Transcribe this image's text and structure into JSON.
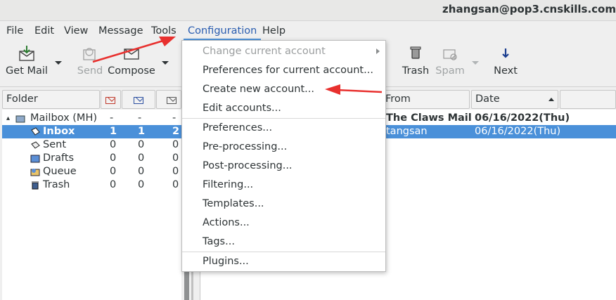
{
  "window": {
    "title": "zhangsan@pop3.cnskills.com"
  },
  "menubar": {
    "items": [
      "File",
      "Edit",
      "View",
      "Message",
      "Tools",
      "Configuration",
      "Help"
    ],
    "active": "Configuration"
  },
  "toolbar": {
    "get_mail": "Get Mail",
    "send": "Send",
    "compose": "Compose",
    "trash": "Trash",
    "spam": "Spam",
    "next": "Next"
  },
  "folder_header": {
    "folder": "Folder"
  },
  "folders": [
    {
      "name": "Mailbox (MH)",
      "c1": "-",
      "c2": "-",
      "c3": "-",
      "icon": "mailbox-icon",
      "selected": false,
      "expander": "▴"
    },
    {
      "name": "Inbox",
      "c1": "1",
      "c2": "1",
      "c3": "2",
      "icon": "inbox-icon",
      "selected": true
    },
    {
      "name": "Sent",
      "c1": "0",
      "c2": "0",
      "c3": "0",
      "icon": "sent-icon",
      "selected": false
    },
    {
      "name": "Drafts",
      "c1": "0",
      "c2": "0",
      "c3": "0",
      "icon": "drafts-icon",
      "selected": false
    },
    {
      "name": "Queue",
      "c1": "0",
      "c2": "0",
      "c3": "0",
      "icon": "queue-icon",
      "selected": false
    },
    {
      "name": "Trash",
      "c1": "0",
      "c2": "0",
      "c3": "0",
      "icon": "trash-icon",
      "selected": false
    }
  ],
  "message_header": {
    "from": "From",
    "date": "Date"
  },
  "messages": [
    {
      "from": "The Claws Mail",
      "date": "06/16/2022(Thu)",
      "bold": true,
      "selected": false
    },
    {
      "from": "tangsan",
      "date": "06/16/2022(Thu)",
      "bold": false,
      "selected": true
    }
  ],
  "configuration_menu": {
    "items": [
      {
        "label": "Change current account",
        "disabled": true,
        "submenu": true
      },
      {
        "label": "Preferences for current account...",
        "disabled": false
      },
      {
        "label": "Create new account...",
        "disabled": false
      },
      {
        "label": "Edit accounts...",
        "disabled": false
      },
      {
        "label": "Preferences...",
        "disabled": false
      },
      {
        "label": "Pre-processing...",
        "disabled": false
      },
      {
        "label": "Post-processing...",
        "disabled": false
      },
      {
        "label": "Filtering...",
        "disabled": false
      },
      {
        "label": "Templates...",
        "disabled": false
      },
      {
        "label": "Actions...",
        "disabled": false
      },
      {
        "label": "Tags...",
        "disabled": false
      },
      {
        "label": "Plugins...",
        "disabled": false
      }
    ]
  },
  "colors": {
    "selection": "#4a90d9",
    "annotation_arrow": "#e8302e"
  }
}
